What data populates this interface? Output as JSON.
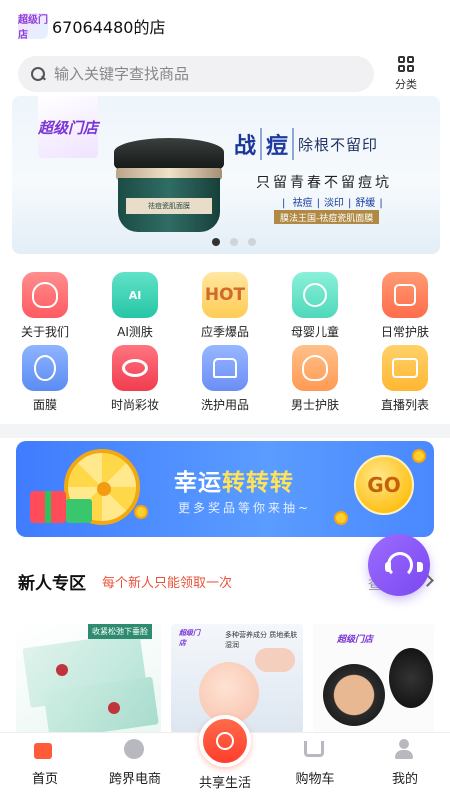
{
  "header": {
    "logo_text": "超级门店",
    "store_name": "67064480的店"
  },
  "search": {
    "placeholder": "输入关键字查找商品",
    "category_label": "分类"
  },
  "banner": {
    "logo_text": "超级门店",
    "jar_label": "祛痘瓷肌面膜",
    "headline_prefix": "战",
    "headline_word": "痘",
    "headline_rest": "除根不留印",
    "subline": "只留青春不留痘坑",
    "tags": [
      "祛痘",
      "淡印",
      "舒缓"
    ],
    "ribbon": "膜法王国-祛痘瓷肌面膜",
    "slide_count": 3,
    "active_slide": 1
  },
  "grid": [
    {
      "label": "关于我们",
      "icon": "about-icon"
    },
    {
      "label": "AI测肤",
      "icon": "ai-skin-icon",
      "badge": "AI"
    },
    {
      "label": "应季爆品",
      "icon": "hot-icon",
      "badge": "HOT"
    },
    {
      "label": "母婴儿童",
      "icon": "baby-icon"
    },
    {
      "label": "日常护肤",
      "icon": "bag-icon"
    },
    {
      "label": "面膜",
      "icon": "mask-icon"
    },
    {
      "label": "时尚彩妆",
      "icon": "lips-icon"
    },
    {
      "label": "洗护用品",
      "icon": "shirt-icon"
    },
    {
      "label": "男士护肤",
      "icon": "man-icon"
    },
    {
      "label": "直播列表",
      "icon": "live-icon"
    }
  ],
  "lucky": {
    "title_prefix": "幸运",
    "title_accent": "转转转",
    "subtitle": "更多奖品等你来抽~",
    "go_label": "GO"
  },
  "new_zone": {
    "title": "新人专区",
    "subtitle": "每个新人只能领取一次",
    "more_label": "查看更多"
  },
  "products": {
    "p1_tag": "收紧松弛下垂脸",
    "p2_tagline": "多种营养成分 质地柔肤湿润",
    "p2_logo": "超级门店",
    "p3_logo": "超级门店"
  },
  "tabbar": [
    {
      "label": "首页",
      "icon": "home-icon",
      "active": true
    },
    {
      "label": "跨界电商",
      "icon": "globe-icon"
    },
    {
      "label": "共享生活",
      "icon": "share-life-icon"
    },
    {
      "label": "购物车",
      "icon": "cart-icon"
    },
    {
      "label": "我的",
      "icon": "user-icon"
    }
  ],
  "colors": {
    "accent": "#ff5a3a",
    "brand_purple": "#7a48f0",
    "lucky_blue": "#4a88ff",
    "new_zone_red": "#e8533a"
  }
}
